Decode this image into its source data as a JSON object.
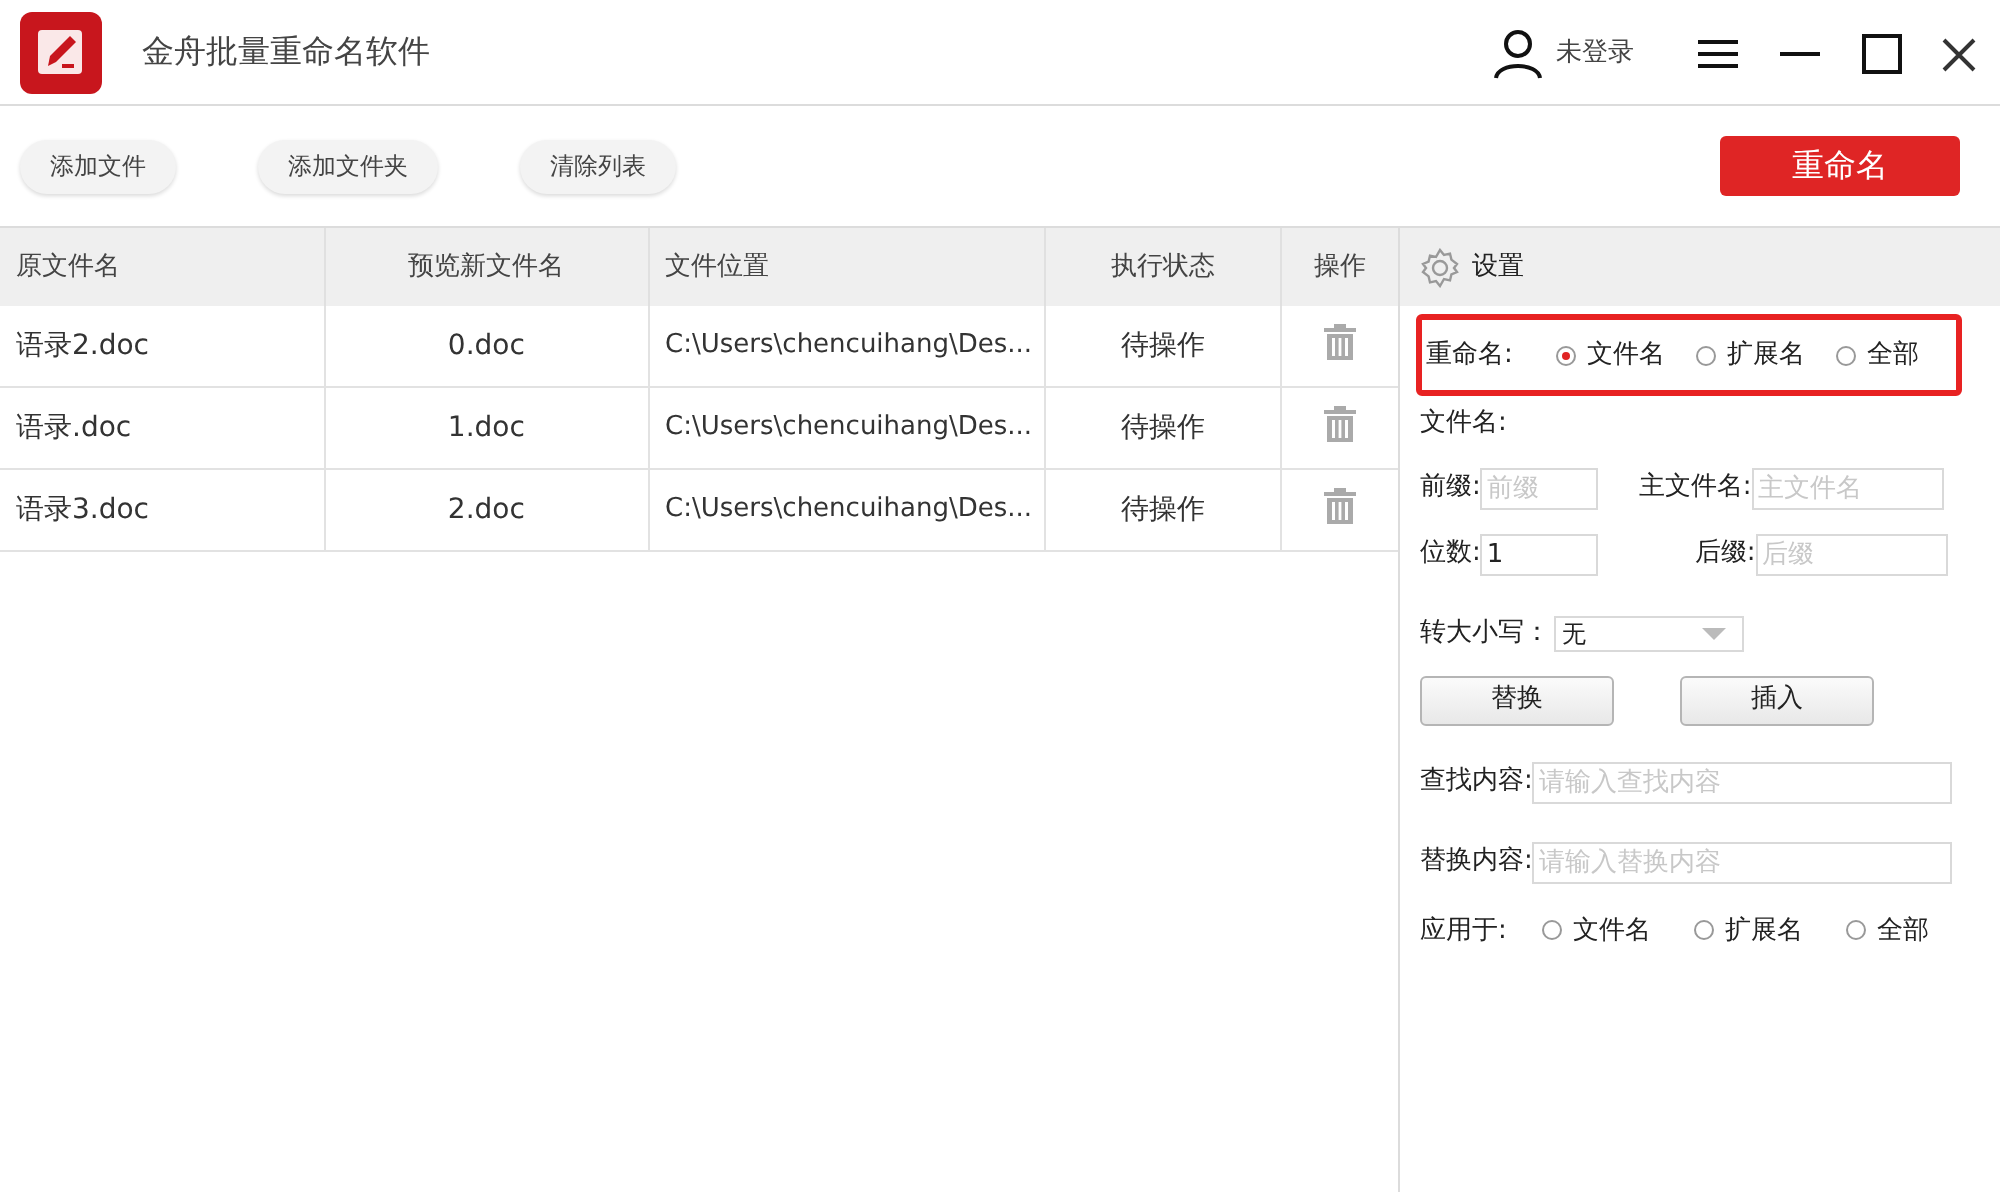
{
  "window": {
    "title": "金舟批量重命名软件",
    "user": "未登录"
  },
  "toolbar": {
    "buttons": [
      "添加文件",
      "添加文件夹",
      "清除列表"
    ],
    "primary": "重命名"
  },
  "table": {
    "columns": [
      "原文件名",
      "预览新文件名",
      "文件位置",
      "执行状态",
      "操作"
    ],
    "rows": [
      {
        "name": "语录2.doc",
        "preview": "0.doc",
        "location": "C:\\Users\\chencuihang\\Des...",
        "status": "待操作"
      },
      {
        "name": "语录.doc",
        "preview": "1.doc",
        "location": "C:\\Users\\chencuihang\\Des...",
        "status": "待操作"
      },
      {
        "name": "语录3.doc",
        "preview": "2.doc",
        "location": "C:\\Users\\chencuihang\\Des...",
        "status": "待操作"
      }
    ]
  },
  "settings": {
    "title": "设置",
    "rename": {
      "label": "重命名:",
      "highlighted": true,
      "options": [
        {
          "label": "文件名",
          "selected": true
        },
        {
          "label": "扩展名",
          "selected": false
        },
        {
          "label": "全部",
          "selected": false
        }
      ]
    },
    "filename_label": "文件名:",
    "prefix": {
      "label": "前缀:",
      "placeholder": "前缀"
    },
    "main_name": {
      "label": "主文件名:",
      "placeholder": "主文件名"
    },
    "digits": {
      "label": "位数:",
      "value": "1"
    },
    "suffix": {
      "label": "后缀:",
      "placeholder": "后缀"
    },
    "case": {
      "label": "转大小写：",
      "value": "无"
    },
    "mode_buttons": [
      "替换",
      "插入"
    ],
    "find": {
      "label": "查找内容:",
      "placeholder": "请输入查找内容"
    },
    "replace": {
      "label": "替换内容:",
      "placeholder": "请输入替换内容"
    },
    "apply_to": {
      "label": "应用于:",
      "options": [
        {
          "label": "文件名",
          "selected": false
        },
        {
          "label": "扩展名",
          "selected": false
        },
        {
          "label": "全部",
          "selected": false
        }
      ]
    }
  }
}
